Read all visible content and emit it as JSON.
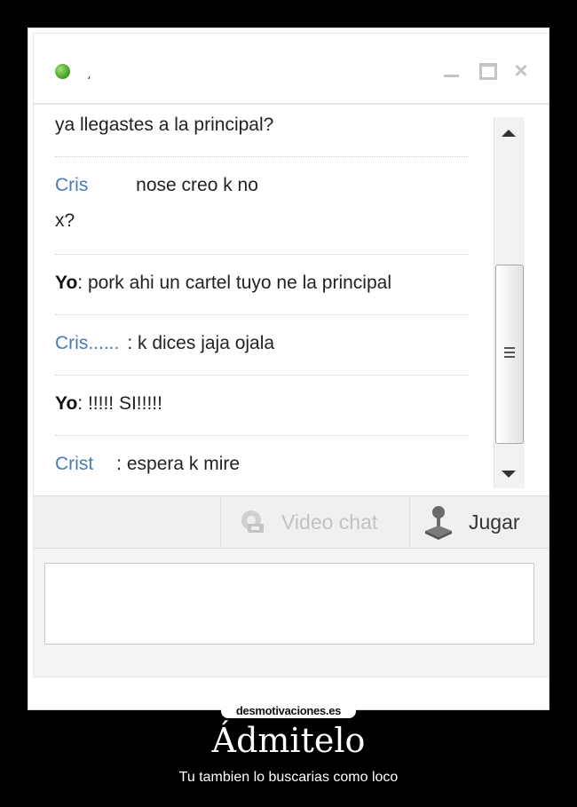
{
  "window": {
    "contact_name": "،",
    "minimize_icon": "minimize-icon",
    "maximize_icon": "maximize-icon",
    "close_label": "×"
  },
  "messages": [
    {
      "sender": "",
      "text": "ya llegastes a la principal?",
      "from": "me"
    },
    {
      "sender": "Cris",
      "text": " nose creo k no",
      "from": "them"
    },
    {
      "sender": "",
      "text": "x?",
      "from": "them"
    },
    {
      "sender": "Yo",
      "text": ": pork ahi un cartel tuyo ne la principal",
      "from": "me"
    },
    {
      "sender": "Cris",
      "text": ": k dices jaja ojala",
      "from": "them"
    },
    {
      "sender": "Yo",
      "text": ": !!!!! SI!!!!!",
      "from": "me"
    },
    {
      "sender": "Crist",
      "text": ": espera k mire",
      "from": "them"
    }
  ],
  "toolbar": {
    "video_chat_label": "Video chat",
    "play_label": "Jugar"
  },
  "input": {
    "placeholder": ""
  },
  "poster": {
    "site": "desmotivaciones.es",
    "title": "Ádmitelo",
    "caption": "Tu tambien lo buscarias como loco"
  },
  "colors": {
    "them_sender": "#4b7cb5",
    "status_online": "#3e9a1e"
  }
}
